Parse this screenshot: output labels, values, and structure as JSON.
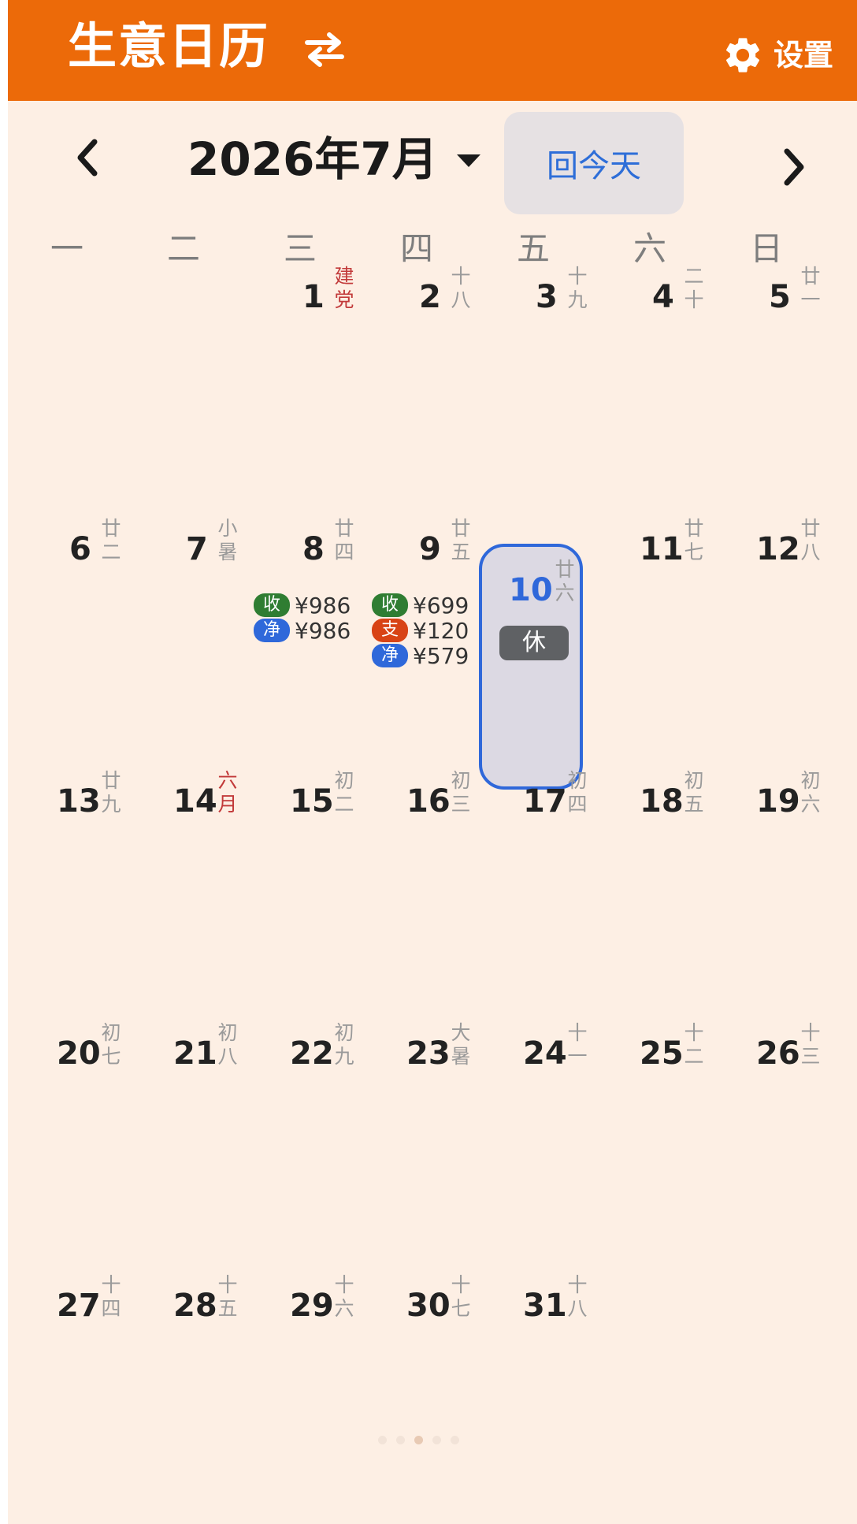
{
  "header": {
    "title": "生意日历",
    "settings_label": "设置",
    "swap_icon": "swap-arrows-icon",
    "gear_icon": "gear-icon",
    "color": "#ec6a09"
  },
  "nav": {
    "month": "2026年7月",
    "today_label": "回今天",
    "prev_icon": "chevron-left-icon",
    "next_icon": "chevron-right-icon"
  },
  "weekdays": [
    "一",
    "二",
    "三",
    "四",
    "五",
    "六",
    "日"
  ],
  "days": [
    {
      "day": "1",
      "lunar": "建党",
      "festival": true
    },
    {
      "day": "2",
      "lunar": "十八"
    },
    {
      "day": "3",
      "lunar": "十九"
    },
    {
      "day": "4",
      "lunar": "二十"
    },
    {
      "day": "5",
      "lunar": "廿一"
    },
    {
      "day": "6",
      "lunar": "廿二"
    },
    {
      "day": "7",
      "lunar": "小暑"
    },
    {
      "day": "8",
      "lunar": "廿四",
      "entries": [
        {
          "tag": "收",
          "amount": "¥986",
          "color": "#2f7d32"
        },
        {
          "tag": "净",
          "amount": "¥986",
          "color": "#2f68da"
        }
      ]
    },
    {
      "day": "9",
      "lunar": "廿五",
      "entries": [
        {
          "tag": "收",
          "amount": "¥699",
          "color": "#2f7d32"
        },
        {
          "tag": "支",
          "amount": "¥120",
          "color": "#d84315"
        },
        {
          "tag": "净",
          "amount": "¥579",
          "color": "#2f68da"
        }
      ]
    },
    {
      "day": "10",
      "lunar": "廿六",
      "selected": true,
      "rest": "休"
    },
    {
      "day": "11",
      "lunar": "廿七"
    },
    {
      "day": "12",
      "lunar": "廿八"
    },
    {
      "day": "13",
      "lunar": "廿九"
    },
    {
      "day": "14",
      "lunar": "六月",
      "festival": true
    },
    {
      "day": "15",
      "lunar": "初二"
    },
    {
      "day": "16",
      "lunar": "初三"
    },
    {
      "day": "17",
      "lunar": "初四"
    },
    {
      "day": "18",
      "lunar": "初五"
    },
    {
      "day": "19",
      "lunar": "初六"
    },
    {
      "day": "20",
      "lunar": "初七"
    },
    {
      "day": "21",
      "lunar": "初八"
    },
    {
      "day": "22",
      "lunar": "初九"
    },
    {
      "day": "23",
      "lunar": "大暑"
    },
    {
      "day": "24",
      "lunar": "十一"
    },
    {
      "day": "25",
      "lunar": "十二"
    },
    {
      "day": "26",
      "lunar": "十三"
    },
    {
      "day": "27",
      "lunar": "十四"
    },
    {
      "day": "28",
      "lunar": "十五"
    },
    {
      "day": "29",
      "lunar": "十六"
    },
    {
      "day": "30",
      "lunar": "十七"
    },
    {
      "day": "31",
      "lunar": "十八"
    }
  ],
  "first_weekday_index": 2,
  "pager": {
    "count": 5,
    "active": 2
  }
}
